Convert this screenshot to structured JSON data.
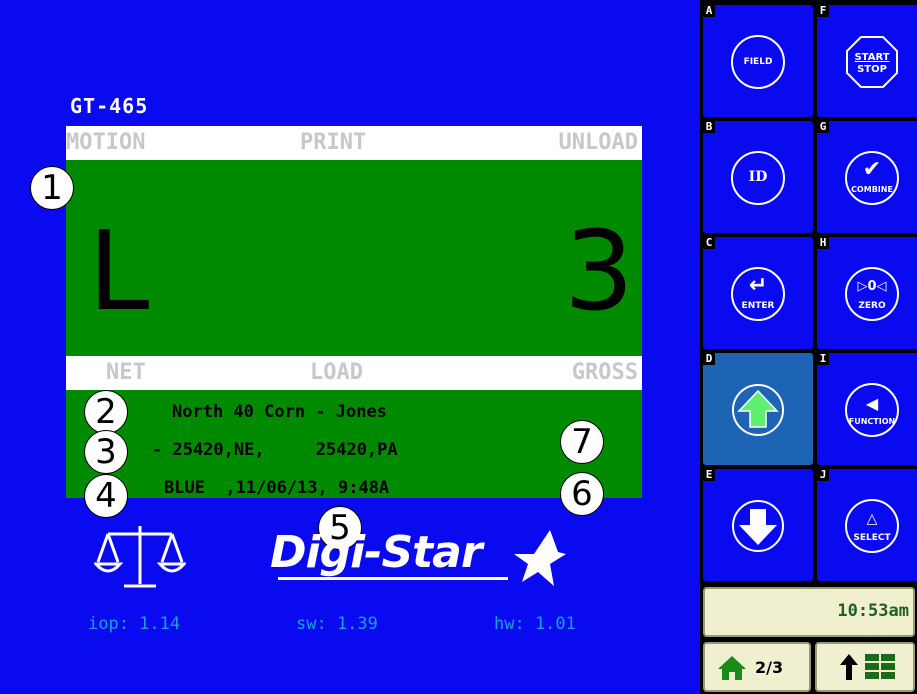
{
  "display": {
    "model": "GT-465",
    "top_labels": [
      "MOTION",
      "PRINT",
      "UNLOAD"
    ],
    "bottom_labels": [
      "NET",
      "LOAD",
      "GROSS"
    ],
    "main_left": "L",
    "main_right": "3",
    "info_line1": "North 40 Corn - Jones",
    "info_line2": "- 25420,NE,     25420,PA",
    "info_line3": "BLUE  ,11/06/13, 9:48A",
    "callouts": [
      "1",
      "2",
      "3",
      "4",
      "5",
      "6",
      "7"
    ],
    "logo": "Digi-Star",
    "version": {
      "iop": "iop: 1.14",
      "sw": "sw: 1.39",
      "hw": "hw: 1.01"
    }
  },
  "softkeys": [
    {
      "letter": "A",
      "label": "FIELD",
      "icon": "field-icon"
    },
    {
      "letter": "F",
      "label": "START STOP",
      "top": "START",
      "bottom": "STOP",
      "icon": "start-stop-icon"
    },
    {
      "letter": "B",
      "label": "ID",
      "icon": "id-icon"
    },
    {
      "letter": "G",
      "label": "COMBINE",
      "icon": "checkmark-combine-icon"
    },
    {
      "letter": "C",
      "label": "ENTER",
      "icon": "enter-arrow-icon"
    },
    {
      "letter": "H",
      "label": "ZERO",
      "glyph": "▷0◁",
      "icon": "zero-icon"
    },
    {
      "letter": "D",
      "label": "",
      "icon": "arrow-up-icon"
    },
    {
      "letter": "I",
      "label": "FUNCTION",
      "icon": "function-icon"
    },
    {
      "letter": "E",
      "label": "",
      "icon": "arrow-down-icon"
    },
    {
      "letter": "J",
      "label": "SELECT",
      "glyph": "△",
      "icon": "select-icon"
    }
  ],
  "clock": "10:53am",
  "nav": {
    "home_page": "2/3",
    "home_icon": "home-icon",
    "menu_icon": "up-menu-grid-icon"
  },
  "colors": {
    "background": "#0a0af0",
    "display_green": "#008a00",
    "active_key": "#1e64b4",
    "version_text": "#1aa0d8"
  }
}
